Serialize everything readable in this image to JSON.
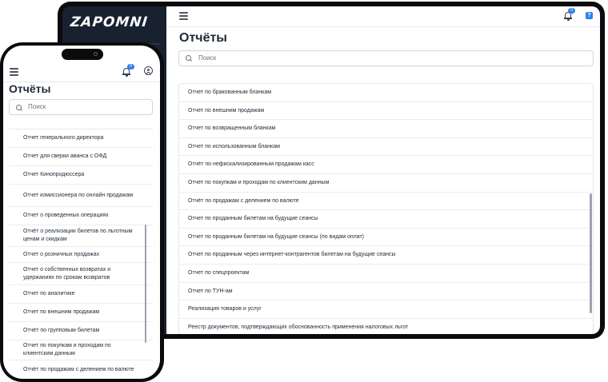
{
  "desktop": {
    "brand": "ZAPOMNI",
    "header": {
      "notification_count": "0",
      "help_label": "?"
    },
    "title": "Отчёты",
    "search": {
      "placeholder": "Поиск"
    },
    "reports": [
      "Отчет по бракованным бланкам",
      "Отчет по внешним продажам",
      "Отчет по возвращенным бланкам",
      "Отчет по использованным бланкам",
      "Отчёт по нефискализированным продажам касс",
      "Отчет по покупкам и проходам по клиентским данным",
      "Отчёт по продажам с делением по валюте",
      "Отчет по проданным билетам на будущие сеансы",
      "Отчет по проданным билетам на будущие сеансы (по видам оплат)",
      "Отчет по проданным через интернет-контрагентов билетам на будущие сеансы",
      "Отчет по спецпроектам",
      "Отчет по ТУН-ам",
      "Реализация товаров и услуг",
      "Реестр документов, подтверждающих обоснованность применения налоговых льгот"
    ]
  },
  "mobile": {
    "header": {
      "notification_count": "0"
    },
    "title": "Отчёты",
    "search": {
      "placeholder": "Поиск"
    },
    "reports": [
      "Отчет генерального директора",
      "Отчет для сверки аванса с ОФД",
      "Отчет Кинопродюссера",
      "Отчет комиссионера по онлайн продажам",
      "Отчет о проведенных операциях",
      "Отчёт о реализации билетов по льготным ценам и скидкам",
      "Отчет о розничных продажах",
      "Отчет о собственных возвратах и удержаниях по срокам возвратов",
      "Отчет по аналитике",
      "Отчет по внешним продажам",
      "Отчёт по групповым билетам",
      "Отчет по покупкам и проходам по клиентским данным",
      "Отчёт по продажам с делением по валюте"
    ]
  },
  "colors": {
    "accent": "#2f80ed",
    "sidebar": "#17212f",
    "frame": "#0b0b0e"
  },
  "icons": [
    "menu-icon",
    "bell-icon",
    "help-icon",
    "search-icon",
    "user-icon"
  ]
}
